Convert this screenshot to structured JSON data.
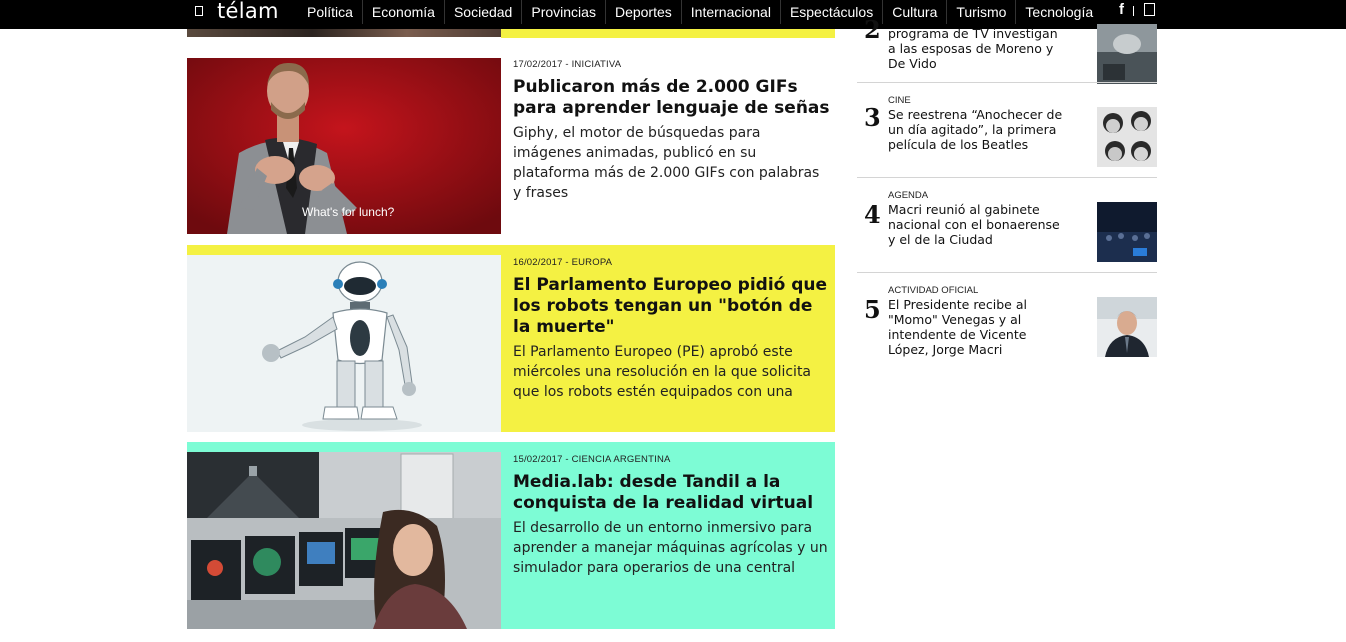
{
  "header": {
    "logo": "télam",
    "nav": [
      "Política",
      "Economía",
      "Sociedad",
      "Provincias",
      "Deportes",
      "Internacional",
      "Espectáculos",
      "Cultura",
      "Turismo",
      "Tecnología"
    ],
    "social_facebook": "f",
    "icons": [
      "menu-icon",
      "facebook-icon",
      "user-icon"
    ]
  },
  "articles": [
    {
      "date": "17/02/2017 - INICIATIVA",
      "title": "Publicaron más de 2.000 GIFs para aprender lenguaje de señas",
      "summary": "Giphy, el motor de búsquedas para imágenes animadas, publicó en su plataforma más de 2.000 GIFs con palabras y frases",
      "caption": "What's for lunch?",
      "background": "#ffffff"
    },
    {
      "date": "16/02/2017 - EUROPA",
      "title": "El Parlamento Europeo pidió que los robots tengan un \"botón de la muerte\"",
      "summary": "El Parlamento Europeo (PE) aprobó este miércoles una resolución en la que solicita que los robots estén equipados con una",
      "background": "#f4f143"
    },
    {
      "date": "15/02/2017 - CIENCIA ARGENTINA",
      "title": "Media.lab: desde Tandil a la conquista de la realidad virtual",
      "summary": "El desarrollo de un entorno inmersivo para aprender a manejar máquinas agrícolas y un simulador para operarios de una central",
      "background": "#7dfcd5"
    }
  ],
  "sidebar": {
    "items": [
      {
        "rank": "2",
        "category": "",
        "title": "programa de TV investigan a las esposas de Moreno y De Vido"
      },
      {
        "rank": "3",
        "category": "CINE",
        "title": "Se reestrena “Anochecer de un día agitado”, la primera película de los Beatles"
      },
      {
        "rank": "4",
        "category": "AGENDA",
        "title": "Macri reunió al gabinete nacional con el bonaerense y el de la Ciudad"
      },
      {
        "rank": "5",
        "category": "ACTIVIDAD OFICIAL",
        "title": "El Presidente recibe al \"Momo\" Venegas y al intendente de Vicente López, Jorge Macri"
      }
    ]
  },
  "colors": {
    "nav_bg": "#000000",
    "yellow": "#f4f143",
    "mint": "#7dfcd5"
  }
}
